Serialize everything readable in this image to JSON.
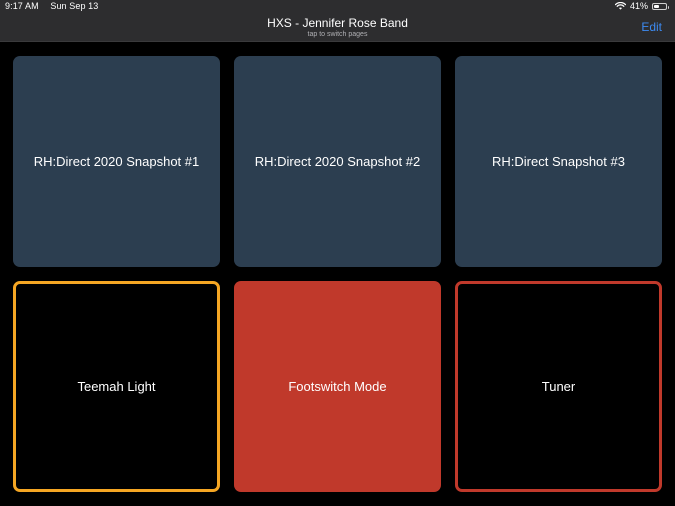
{
  "status_bar": {
    "time": "9:17 AM",
    "date": "Sun Sep 13",
    "battery": "41%",
    "battery_level": 0.41,
    "wifi_icon": "wifi-icon",
    "battery_icon": "battery-icon"
  },
  "header": {
    "title": "HXS - Jennifer Rose Band",
    "subtitle": "tap to switch pages",
    "edit_label": "Edit"
  },
  "colors": {
    "snapshot_pad": "#2c3e50",
    "accent_orange": "#f5a623",
    "accent_red": "#c0392b",
    "link_blue": "#3d8bf2"
  },
  "pads": [
    {
      "label": "RH:Direct 2020 Snapshot #1",
      "style": "snapshot"
    },
    {
      "label": "RH:Direct 2020 Snapshot #2",
      "style": "snapshot"
    },
    {
      "label": "RH:Direct Snapshot #3",
      "style": "snapshot"
    },
    {
      "label": "Teemah Light",
      "style": "outline-orange"
    },
    {
      "label": "Footswitch Mode",
      "style": "filled-red"
    },
    {
      "label": "Tuner",
      "style": "outline-red"
    }
  ]
}
